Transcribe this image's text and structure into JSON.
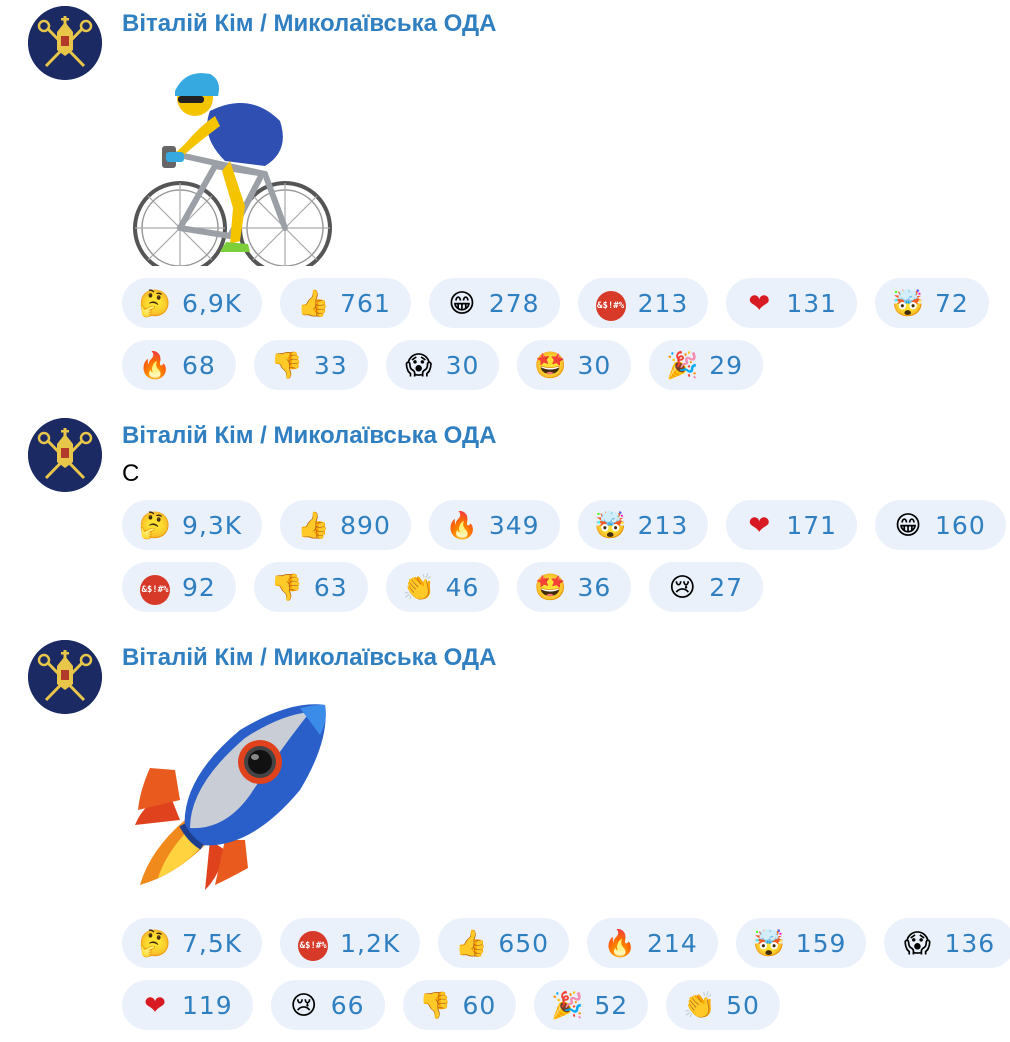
{
  "messages": [
    {
      "author": "Віталій Кім / Миколаївська ОДА",
      "text": "",
      "sticker": "cyclist-sticker",
      "reactions": [
        [
          {
            "icon": "thinking-face-icon",
            "emoji": "🤔",
            "count": "6,9K"
          },
          {
            "icon": "thumbs-up-icon",
            "emoji": "👍",
            "count": "761"
          },
          {
            "icon": "grinning-face-icon",
            "emoji": "😁",
            "count": "278"
          },
          {
            "icon": "cursing-face-icon",
            "emoji": "&$!#%",
            "count": "213"
          },
          {
            "icon": "red-heart-icon",
            "emoji": "❤️",
            "count": "131"
          },
          {
            "icon": "exploding-head-icon",
            "emoji": "🤯",
            "count": "72"
          }
        ],
        [
          {
            "icon": "fire-icon",
            "emoji": "🔥",
            "count": "68"
          },
          {
            "icon": "thumbs-down-icon",
            "emoji": "👎",
            "count": "33"
          },
          {
            "icon": "screaming-face-icon",
            "emoji": "😱",
            "count": "30"
          },
          {
            "icon": "star-struck-icon",
            "emoji": "🤩",
            "count": "30"
          },
          {
            "icon": "party-popper-icon",
            "emoji": "🎉",
            "count": "29"
          }
        ]
      ]
    },
    {
      "author": "Віталій Кім / Миколаївська ОДА",
      "text": "С",
      "sticker": "",
      "reactions": [
        [
          {
            "icon": "thinking-face-icon",
            "emoji": "🤔",
            "count": "9,3K"
          },
          {
            "icon": "thumbs-up-icon",
            "emoji": "👍",
            "count": "890"
          },
          {
            "icon": "fire-icon",
            "emoji": "🔥",
            "count": "349"
          },
          {
            "icon": "exploding-head-icon",
            "emoji": "🤯",
            "count": "213"
          },
          {
            "icon": "red-heart-icon",
            "emoji": "❤️",
            "count": "171"
          },
          {
            "icon": "grinning-face-icon",
            "emoji": "😁",
            "count": "160"
          }
        ],
        [
          {
            "icon": "cursing-face-icon",
            "emoji": "&$!#%",
            "count": "92"
          },
          {
            "icon": "thumbs-down-icon",
            "emoji": "👎",
            "count": "63"
          },
          {
            "icon": "clapping-hands-icon",
            "emoji": "👏",
            "count": "46"
          },
          {
            "icon": "star-struck-icon",
            "emoji": "🤩",
            "count": "36"
          },
          {
            "icon": "crying-face-icon",
            "emoji": "😢",
            "count": "27"
          }
        ]
      ]
    },
    {
      "author": "Віталій Кім / Миколаївська ОДА",
      "text": "",
      "sticker": "rocket-sticker",
      "reactions": [
        [
          {
            "icon": "thinking-face-icon",
            "emoji": "🤔",
            "count": "7,5K"
          },
          {
            "icon": "cursing-face-icon",
            "emoji": "&$!#%",
            "count": "1,2K"
          },
          {
            "icon": "thumbs-up-icon",
            "emoji": "👍",
            "count": "650"
          },
          {
            "icon": "fire-icon",
            "emoji": "🔥",
            "count": "214"
          },
          {
            "icon": "exploding-head-icon",
            "emoji": "🤯",
            "count": "159"
          },
          {
            "icon": "screaming-face-icon",
            "emoji": "😱",
            "count": "136"
          }
        ],
        [
          {
            "icon": "red-heart-icon",
            "emoji": "❤️",
            "count": "119"
          },
          {
            "icon": "crying-face-icon",
            "emoji": "😢",
            "count": "66"
          },
          {
            "icon": "thumbs-down-icon",
            "emoji": "👎",
            "count": "60"
          },
          {
            "icon": "party-popper-icon",
            "emoji": "🎉",
            "count": "52"
          },
          {
            "icon": "clapping-hands-icon",
            "emoji": "👏",
            "count": "50"
          }
        ]
      ]
    }
  ]
}
